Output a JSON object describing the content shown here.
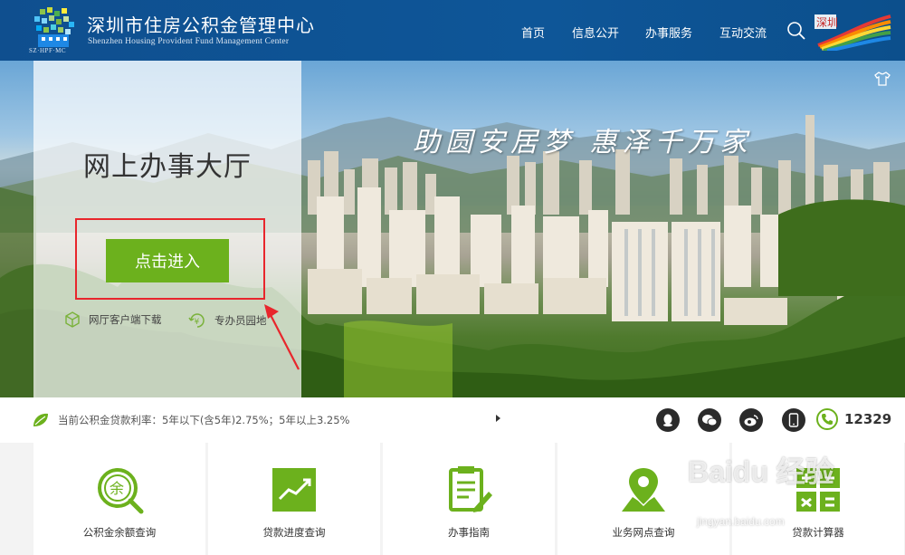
{
  "header": {
    "logo_caption": "SZ·HPF·MC",
    "title": "深圳市住房公积金管理中心",
    "subtitle": "Shenzhen Housing Provident Fund Management Center",
    "nav": [
      {
        "label": "首页"
      },
      {
        "label": "信息公开"
      },
      {
        "label": "办事服务"
      },
      {
        "label": "互动交流"
      }
    ],
    "search_icon": "search-icon",
    "badge_text": "深圳"
  },
  "hero": {
    "slogan": "助圆安居梦 惠泽千万家",
    "panel_title": "网上办事大厅",
    "enter_button": "点击进入",
    "links": [
      {
        "label": "网厅客户端下载",
        "icon": "package-icon"
      },
      {
        "label": "专办员园地",
        "icon": "coin-icon"
      }
    ]
  },
  "strip": {
    "rate_text": "当前公积金贷款利率：5年以下(含5年)2.75%；5年以上3.25%",
    "hotline": "12329"
  },
  "tiles": [
    {
      "label": "公积金余额查询",
      "icon": "balance-search-icon",
      "glyph": "余"
    },
    {
      "label": "贷款进度查询",
      "icon": "trend-chart-icon"
    },
    {
      "label": "办事指南",
      "icon": "guide-document-icon"
    },
    {
      "label": "业务网点查询",
      "icon": "map-pin-icon"
    },
    {
      "label": "贷款计算器",
      "icon": "calculator-icon"
    }
  ],
  "watermark": {
    "main": "Baidu 经验",
    "sub": "jingyan.baidu.com"
  },
  "colors": {
    "header_blue": "#0e5698",
    "accent_green": "#6cb11d",
    "highlight_red": "#e8262c"
  }
}
